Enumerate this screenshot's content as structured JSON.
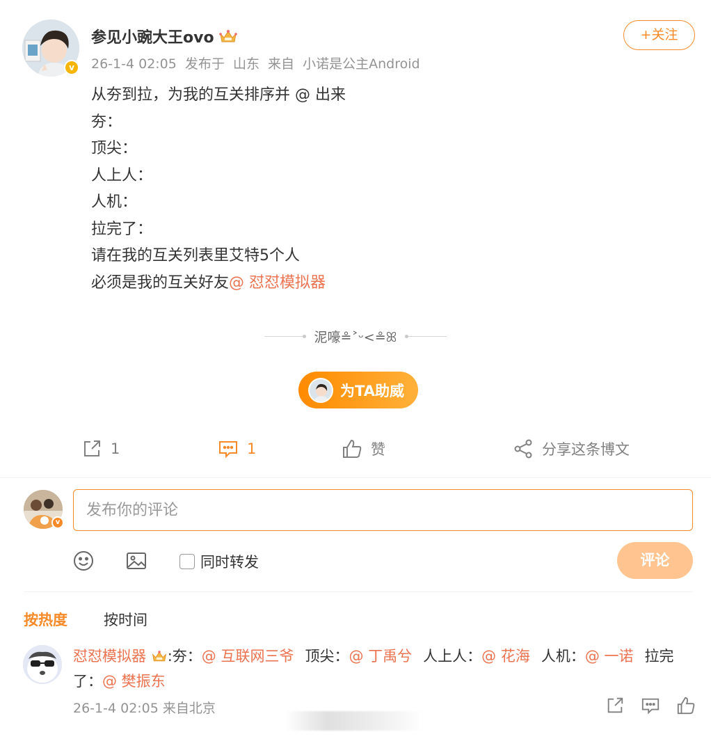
{
  "post": {
    "author_name": "参见小豌大王ovo",
    "crown_icon": "crown-icon",
    "verified_icon": "verified-badge-icon",
    "timestamp": "26-1-4 02:05",
    "published_in_label": "发布于",
    "location": "山东",
    "source_label": "来自",
    "source": "小诺是公主Android",
    "follow_label": "+关注",
    "content_lines": [
      "从夯到拉，为我的互关排序并 @ 出来",
      "夯：",
      "顶尖：",
      "人上人：",
      "人机：",
      "拉完了：",
      "请在我的互关列表里艾特5个人"
    ],
    "last_line_prefix": "必须是我的互关好友",
    "last_line_mention": "@ 怼怼模拟器",
    "signature": "泥嚎≗˃ᵕ<≗ꕤ",
    "cheer_label": "为TA助威"
  },
  "actions": {
    "repost_count": "1",
    "comment_count": "1",
    "like_label": "赞",
    "share_label": "分享这条博文"
  },
  "composer": {
    "placeholder": "发布你的评论",
    "repost_label": "同时转发",
    "submit_label": "评论"
  },
  "sort": {
    "hot_label": "按热度",
    "time_label": "按时间"
  },
  "comment": {
    "username": "怼怼模拟器",
    "sep": ":",
    "tier1_label": "夯：",
    "tier1_mention": "@ 互联网三爷",
    "tier2_label": "顶尖：",
    "tier2_mention": "@ 丁禹兮",
    "tier3_label": "人上人：",
    "tier3_mention": "@ 花海",
    "tier4_label": "人机：",
    "tier4_mention": "@ 一诺",
    "tier5_label": "拉完了：",
    "tier5_mention": "@ 樊振东",
    "timestamp": "26-1-4 02:05",
    "source": "来自北京"
  },
  "colors": {
    "accent": "#f78a28",
    "mention": "#eb7350",
    "meta": "#939393",
    "submit_disabled": "#ffc48f"
  }
}
